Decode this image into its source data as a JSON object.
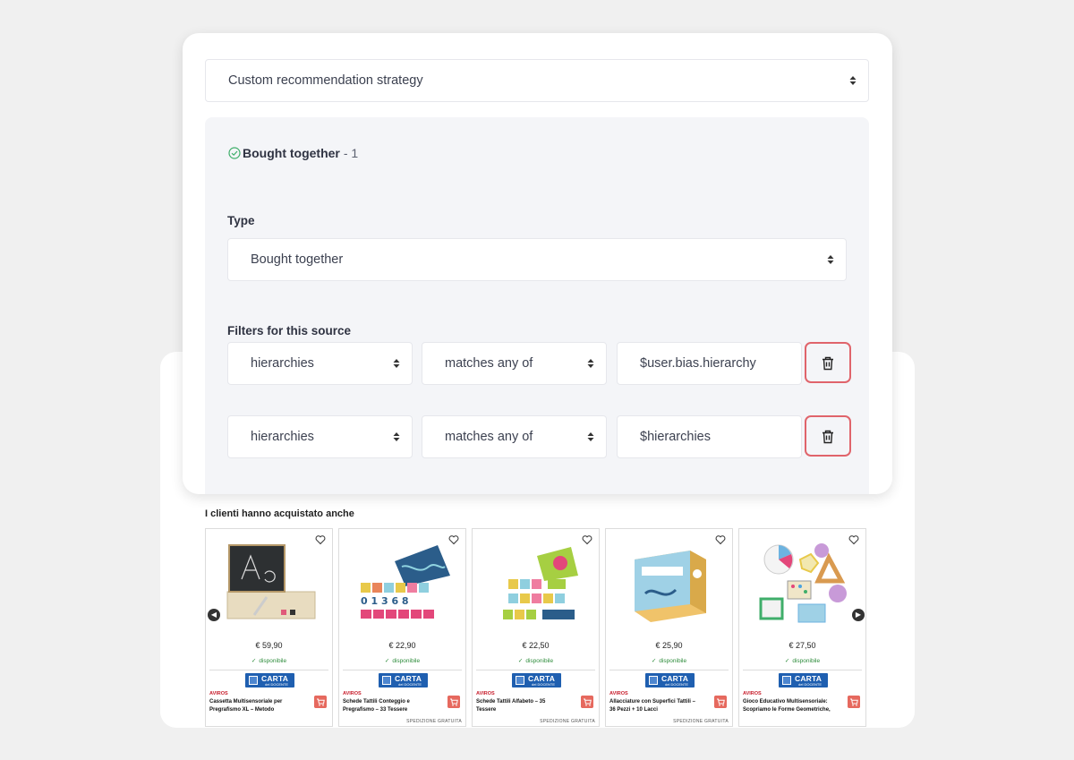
{
  "strategy": {
    "selected": "Custom recommendation strategy"
  },
  "source": {
    "title": "Bought together",
    "index": "- 1",
    "actions": [
      "arrow-up-icon",
      "arrow-down-icon",
      "duplicate-icon",
      "trash-icon"
    ],
    "type_label": "Type",
    "type_selected": "Bought together",
    "filters_label": "Filters for this source",
    "filters": [
      {
        "field": "hierarchies",
        "operator": "matches any of",
        "value": "$user.bias.hierarchy"
      },
      {
        "field": "hierarchies",
        "operator": "matches any of",
        "value": "$hierarchies"
      }
    ]
  },
  "storefront": {
    "section_title": "I clienti hanno acquistato anche",
    "carta_label": "CARTA",
    "carta_sub": "del DOCENTE",
    "products": [
      {
        "price": "€ 59,90",
        "availability": "disponibile",
        "brand": "AVIROS",
        "name": "Cassetta Multisensoriale per Pregrafismo XL – Metodo",
        "shipping": ""
      },
      {
        "price": "€ 22,90",
        "availability": "disponibile",
        "brand": "AVIROS",
        "name": "Schede Tattili Conteggio e Pregrafismo – 33 Tessere",
        "shipping": "SPEDIZIONE GRATUITA"
      },
      {
        "price": "€ 22,50",
        "availability": "disponibile",
        "brand": "AVIROS",
        "name": "Schede Tattili Alfabeto – 35 Tessere",
        "shipping": "SPEDIZIONE GRATUITA"
      },
      {
        "price": "€ 25,90",
        "availability": "disponibile",
        "brand": "AVIROS",
        "name": "Allacciature con Superfici Tattili – 36 Pezzi + 10 Lacci",
        "shipping": "SPEDIZIONE GRATUITA"
      },
      {
        "price": "€ 27,50",
        "availability": "disponibile",
        "brand": "AVIROS",
        "name": "Gioco Educativo Multisensoriale: Scopriamo le Forme Geometriche,",
        "shipping": ""
      }
    ]
  },
  "colors": {
    "accent_pink": "#d6457a",
    "danger": "#e0646b",
    "check_green": "#3fae6a",
    "carta_blue": "#1f5fb0"
  }
}
